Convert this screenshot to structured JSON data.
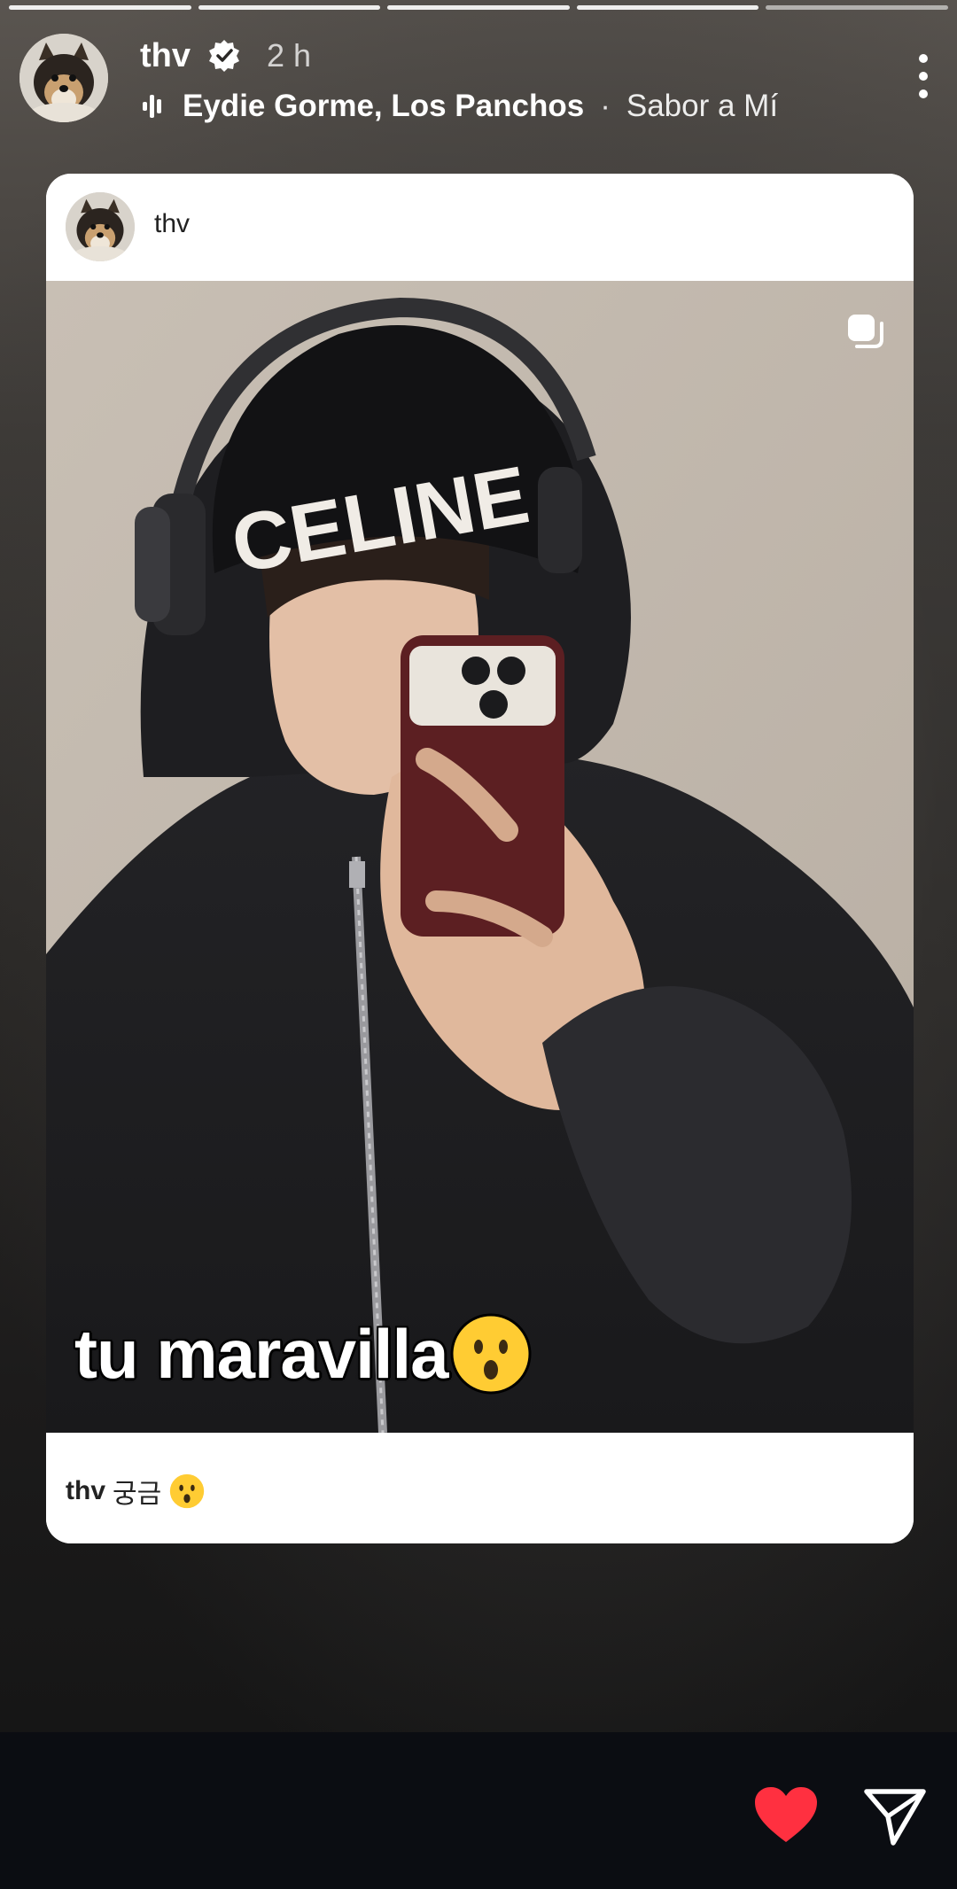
{
  "story": {
    "progress_segments": 5,
    "header": {
      "username": "thv",
      "verified_icon": "verified-badge-icon",
      "time_ago": "2 h",
      "music_icon": "music-bars-icon",
      "music_artist": "Eydie Gorme, Los Panchos",
      "music_separator": "·",
      "music_track": "Sabor a Mí",
      "more_icon": "more-vertical-icon"
    },
    "shared_post": {
      "username": "thv",
      "multi_media_icon": "carousel-icon",
      "overlay_text": "tu maravilla",
      "overlay_emoji": "hushed-face-emoji",
      "caption_username": "thv",
      "caption_text": "궁금",
      "caption_emoji": "hushed-face-emoji",
      "beanie_lettering": "CELINE"
    },
    "actions": {
      "like_icon": "heart-icon",
      "share_icon": "send-icon",
      "like_color": "#ff3040"
    }
  }
}
